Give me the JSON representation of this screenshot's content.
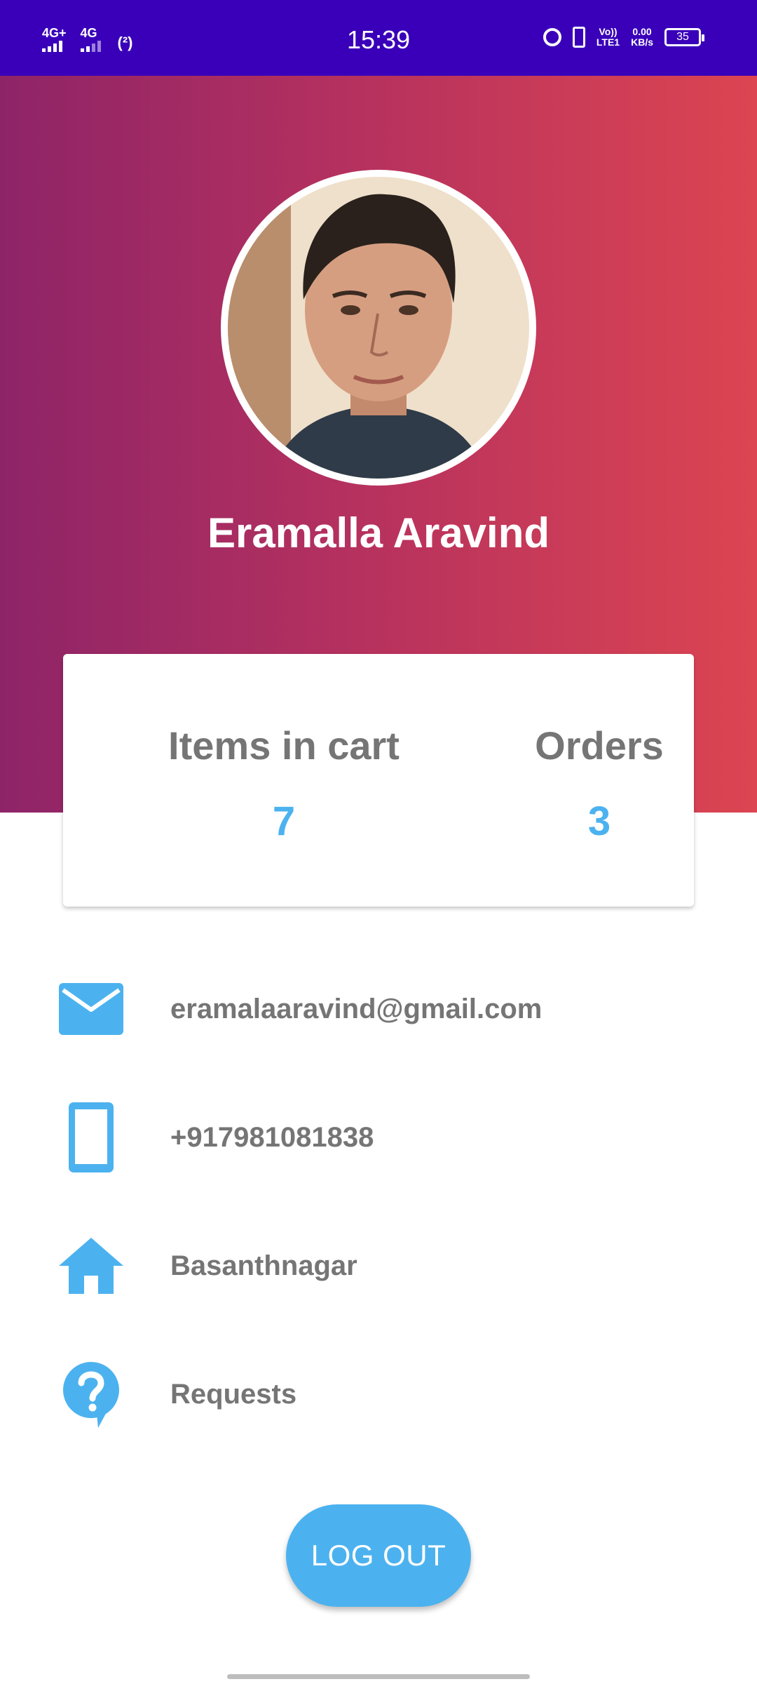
{
  "status_bar": {
    "net1": "4G+",
    "net2": "4G",
    "hotspot": "(²)",
    "time": "15:39",
    "volte_top": "Vo))",
    "volte_bottom": "LTE1",
    "speed_value": "0.00",
    "speed_unit": "KB/s",
    "battery": "35"
  },
  "profile": {
    "name": "Eramalla Aravind"
  },
  "stats": {
    "cart_label": "Items in cart",
    "cart_value": "7",
    "orders_label": "Orders",
    "orders_value": "3"
  },
  "info": {
    "email": "eramalaaravind@gmail.com",
    "phone": "+917981081838",
    "address": "Basanthnagar",
    "requests": "Requests"
  },
  "logout_label": "LOG OUT",
  "colors": {
    "status_bar": "#3a00b9",
    "gradient_start": "#8e2468",
    "gradient_end": "#dc4551",
    "accent": "#4cb2ef",
    "text_gray": "#757575"
  },
  "icons": {
    "email": "envelope-icon",
    "phone": "smartphone-icon",
    "address": "home-icon",
    "requests": "help-question-icon"
  }
}
